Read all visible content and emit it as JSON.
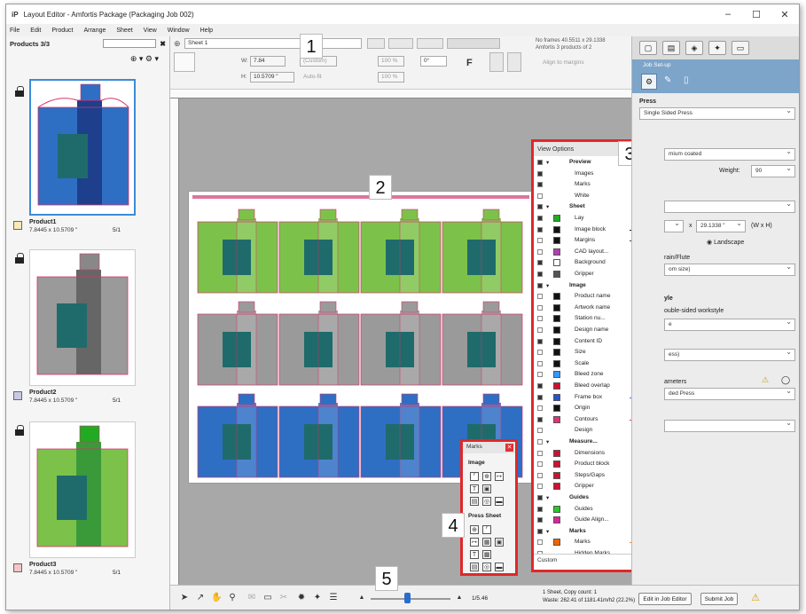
{
  "app": {
    "logo": "iP",
    "title": "Layout Editor - Amfortis Package (Packaging Job 002)"
  },
  "menu": [
    "File",
    "Edit",
    "Product",
    "Arrange",
    "Sheet",
    "View",
    "Window",
    "Help"
  ],
  "left_panel": {
    "header": "Products 3/3",
    "products": [
      {
        "name": "Product1",
        "size": "7.8445 x 10.5709 \"",
        "count": "5/1",
        "swatch": "#f7e9b8"
      },
      {
        "name": "Product2",
        "size": "7.8445 x 10.5709 \"",
        "count": "5/1",
        "swatch": "#c9c9e3"
      },
      {
        "name": "Product3",
        "size": "7.8445 x 10.5709 \"",
        "count": "5/1",
        "swatch": "#f4c6c6"
      }
    ]
  },
  "toolbar": {
    "sheet": "Sheet 1",
    "width_label": "W:",
    "width_value": "7.84",
    "height_label": "H:",
    "height_value": "10.5709 \"",
    "custom": "(Custom)",
    "auto_fit": "Auto-fit",
    "scale_x": "100 %",
    "scale_y": "100 %",
    "rotation": "0°",
    "align": "Align to margins",
    "frames_info": "No frames 40.5511 x 29.1338",
    "frames_info2": "Amfortis 3 products of 2"
  },
  "right_panel": {
    "job_setup": "Job Set-up",
    "press_label": "Press",
    "press_value": "Single Sided Press",
    "paper_value": "mium coated",
    "weight_label": "Weight:",
    "weight_value": "90",
    "size_x": "29.1338 \"",
    "size_unit": "(W x H)",
    "orientation": "Landscape",
    "grain": "rain/Flute",
    "grain_sel": "om size)",
    "workstyle_hdr": "yle",
    "workstyle": "ouble-sided workstyle",
    "ws_sel": "e",
    "ps_sel": "ess)",
    "params": "ameters",
    "params_sel": "ded Press"
  },
  "view_options": {
    "title": "View Options",
    "rows": [
      {
        "label": "Preview",
        "group": true,
        "eye": true,
        "color": null
      },
      {
        "label": "Images",
        "eye": true,
        "color": null
      },
      {
        "label": "Marks",
        "eye": true,
        "color": null
      },
      {
        "label": "White",
        "eye": false,
        "color": null
      },
      {
        "label": "Sheet",
        "group": true,
        "eye": true,
        "color": null
      },
      {
        "label": "Lay",
        "eye": true,
        "color": "#22aa22"
      },
      {
        "label": "Image block",
        "eye": true,
        "color": "#111111",
        "line": "#222222"
      },
      {
        "label": "Margins",
        "eye": false,
        "color": "#111111",
        "line": "#444444"
      },
      {
        "label": "CAD layout...",
        "eye": false,
        "color": "#b040b0"
      },
      {
        "label": "Background",
        "eye": true,
        "color": "#ffffff"
      },
      {
        "label": "Gripper",
        "eye": true,
        "color": "#555555"
      },
      {
        "label": "Image",
        "group": true,
        "eye": true,
        "color": null
      },
      {
        "label": "Product name",
        "eye": false,
        "color": "#111111"
      },
      {
        "label": "Artwork name",
        "eye": false,
        "color": "#111111"
      },
      {
        "label": "Station nu...",
        "eye": false,
        "color": "#111111"
      },
      {
        "label": "Design name",
        "eye": false,
        "color": "#111111"
      },
      {
        "label": "Content ID",
        "eye": true,
        "color": "#111111"
      },
      {
        "label": "Size",
        "eye": false,
        "color": "#111111"
      },
      {
        "label": "Scale",
        "eye": false,
        "color": "#111111"
      },
      {
        "label": "Bleed zone",
        "eye": false,
        "color": "#3399ff"
      },
      {
        "label": "Bleed overlap",
        "eye": true,
        "color": "#cc1133"
      },
      {
        "label": "Frame box",
        "eye": true,
        "color": "#2255cc",
        "line": "#3377dd"
      },
      {
        "label": "Origin",
        "eye": false,
        "color": "#111111"
      },
      {
        "label": "Contours",
        "eye": true,
        "color": "#dd3377",
        "line": "#dd3377"
      },
      {
        "label": "Design",
        "eye": false,
        "color": null
      },
      {
        "label": "Measure...",
        "group": true,
        "eye": false,
        "color": null
      },
      {
        "label": "Dimensions",
        "eye": false,
        "color": "#cc1133"
      },
      {
        "label": "Product block",
        "eye": false,
        "color": "#cc1133"
      },
      {
        "label": "Steps/Gaps",
        "eye": false,
        "color": "#cc1133"
      },
      {
        "label": "Gripper",
        "eye": false,
        "color": "#cc1133"
      },
      {
        "label": "Guides",
        "group": true,
        "eye": true,
        "color": null
      },
      {
        "label": "Guides",
        "eye": true,
        "color": "#22cc22"
      },
      {
        "label": "Guide Align...",
        "eye": true,
        "color": "#dd2299"
      },
      {
        "label": "Marks",
        "group": true,
        "eye": true,
        "color": null
      },
      {
        "label": "Marks",
        "eye": false,
        "color": "#ee6600",
        "line": "#ee8833"
      },
      {
        "label": "Hidden Marks",
        "eye": false,
        "color": null,
        "line": "#ee8833"
      }
    ],
    "footer": "Custom"
  },
  "marks_panel": {
    "title": "Marks",
    "image_label": "Image",
    "press_label": "Press Sheet"
  },
  "statusbar": {
    "zoom": "1/5.46",
    "info1": "1 Sheet, Copy count: 1",
    "info2": "Waste: 262.41 of 1181.41m/h2 (22.2%)",
    "edit_btn": "Edit in Job Editor",
    "submit_btn": "Submit Job"
  },
  "callouts": [
    "1",
    "2",
    "3",
    "4",
    "5"
  ],
  "sheet_colors": {
    "row1": "#7cc24a",
    "row2": "#9a9a9a",
    "row3": "#2e6fc4",
    "art": "#1f6b6b",
    "cut": "#d6336c"
  }
}
